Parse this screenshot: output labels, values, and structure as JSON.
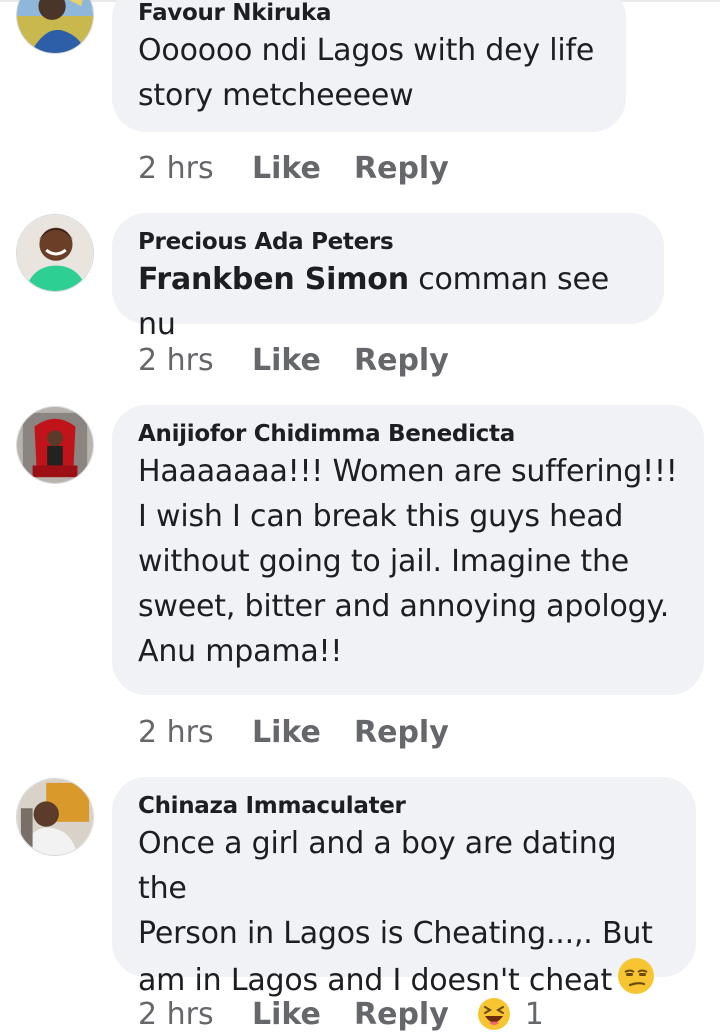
{
  "comments": [
    {
      "author": "Favour Nkiruka",
      "text": "Oooooo ndi Lagos with dey life\nstory metcheeeew",
      "time": "2 hrs",
      "like": "Like",
      "reply": "Reply"
    },
    {
      "author": "Precious Ada Peters",
      "mention": "Frankben Simon",
      "text": " comman see nu",
      "time": "2 hrs",
      "like": "Like",
      "reply": "Reply"
    },
    {
      "author": "Anijiofor Chidimma Benedicta",
      "text": "Haaaaaaa!!! Women are suffering!!!\nI wish I can break this guys head\nwithout going to jail. Imagine the\nsweet, bitter and annoying apology.\nAnu mpama!!",
      "time": "2 hrs",
      "like": "Like",
      "reply": "Reply"
    },
    {
      "author": "Chinaza Immaculater",
      "text": "Once a girl and a boy are dating the\nPerson in Lagos is Cheating...,. But\nam in Lagos and I doesn't cheat",
      "emoji": "unamused-face-icon",
      "time": "2 hrs",
      "like": "Like",
      "reply": "Reply",
      "reaction_icon": "haha-reaction-icon",
      "reaction_count": "1"
    }
  ],
  "colors": {
    "bubble": "#f0f2f5",
    "action_text": "#65676b",
    "author_text": "#1c1e21"
  }
}
